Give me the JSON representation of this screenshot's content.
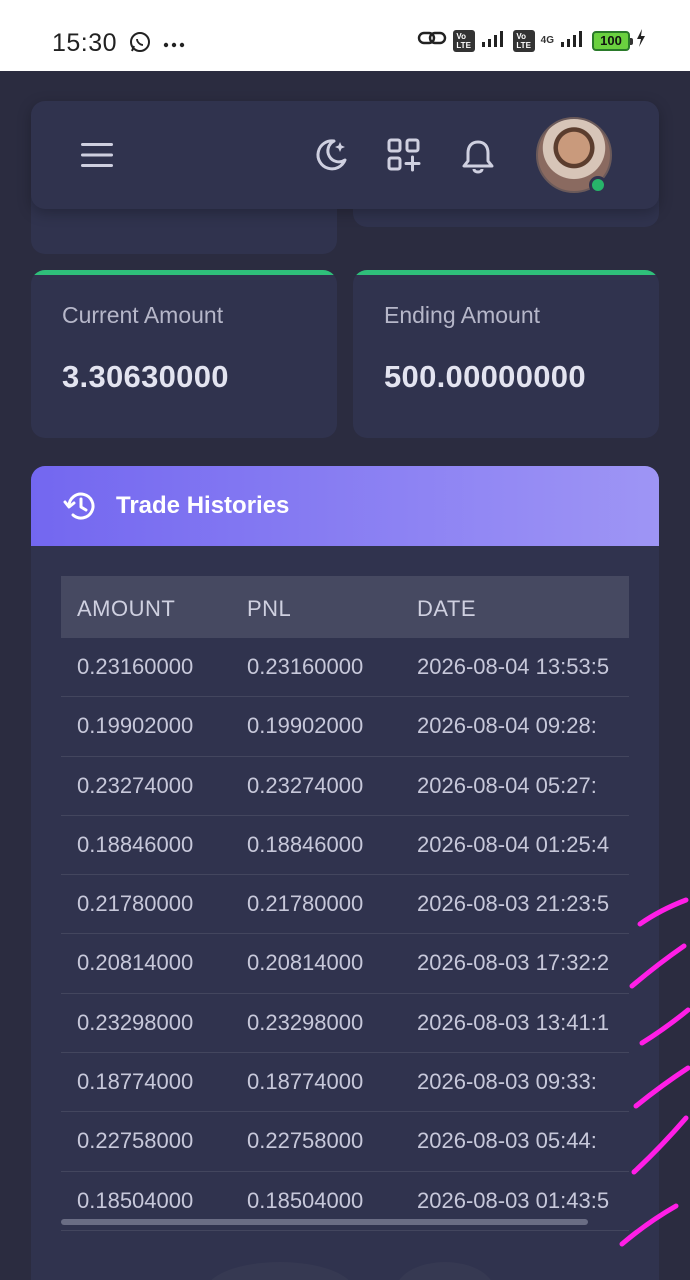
{
  "status_bar": {
    "time": "15:30",
    "battery": "100",
    "network": "4G",
    "volte1": "Vo LTE",
    "volte2": "Vo LTE"
  },
  "navbar": {
    "icons": [
      "menu-icon",
      "moon-star-icon",
      "grid-add-icon",
      "bell-icon"
    ]
  },
  "stats": {
    "current_label": "Current Amount",
    "current_value": "3.30630000",
    "ending_label": "Ending Amount",
    "ending_value": "500.00000000"
  },
  "history": {
    "title": "Trade Histories",
    "columns": [
      "AMOUNT",
      "PNL",
      "DATE"
    ],
    "rows": [
      [
        "0.23160000",
        "0.23160000",
        "2026-08-04 13:53:5"
      ],
      [
        "0.19902000",
        "0.19902000",
        "2026-08-04 09:28:"
      ],
      [
        "0.23274000",
        "0.23274000",
        "2026-08-04 05:27:"
      ],
      [
        "0.18846000",
        "0.18846000",
        "2026-08-04 01:25:4"
      ],
      [
        "0.21780000",
        "0.21780000",
        "2026-08-03 21:23:5"
      ],
      [
        "0.20814000",
        "0.20814000",
        "2026-08-03 17:32:2"
      ],
      [
        "0.23298000",
        "0.23298000",
        "2026-08-03 13:41:1"
      ],
      [
        "0.18774000",
        "0.18774000",
        "2026-08-03 09:33:"
      ],
      [
        "0.22758000",
        "0.22758000",
        "2026-08-03 05:44:"
      ],
      [
        "0.18504000",
        "0.18504000",
        "2026-08-03 01:43:5"
      ]
    ]
  },
  "colors": {
    "accent": "#7367f0",
    "success": "#2fbf7a",
    "annotation": "#ff1ee6"
  }
}
